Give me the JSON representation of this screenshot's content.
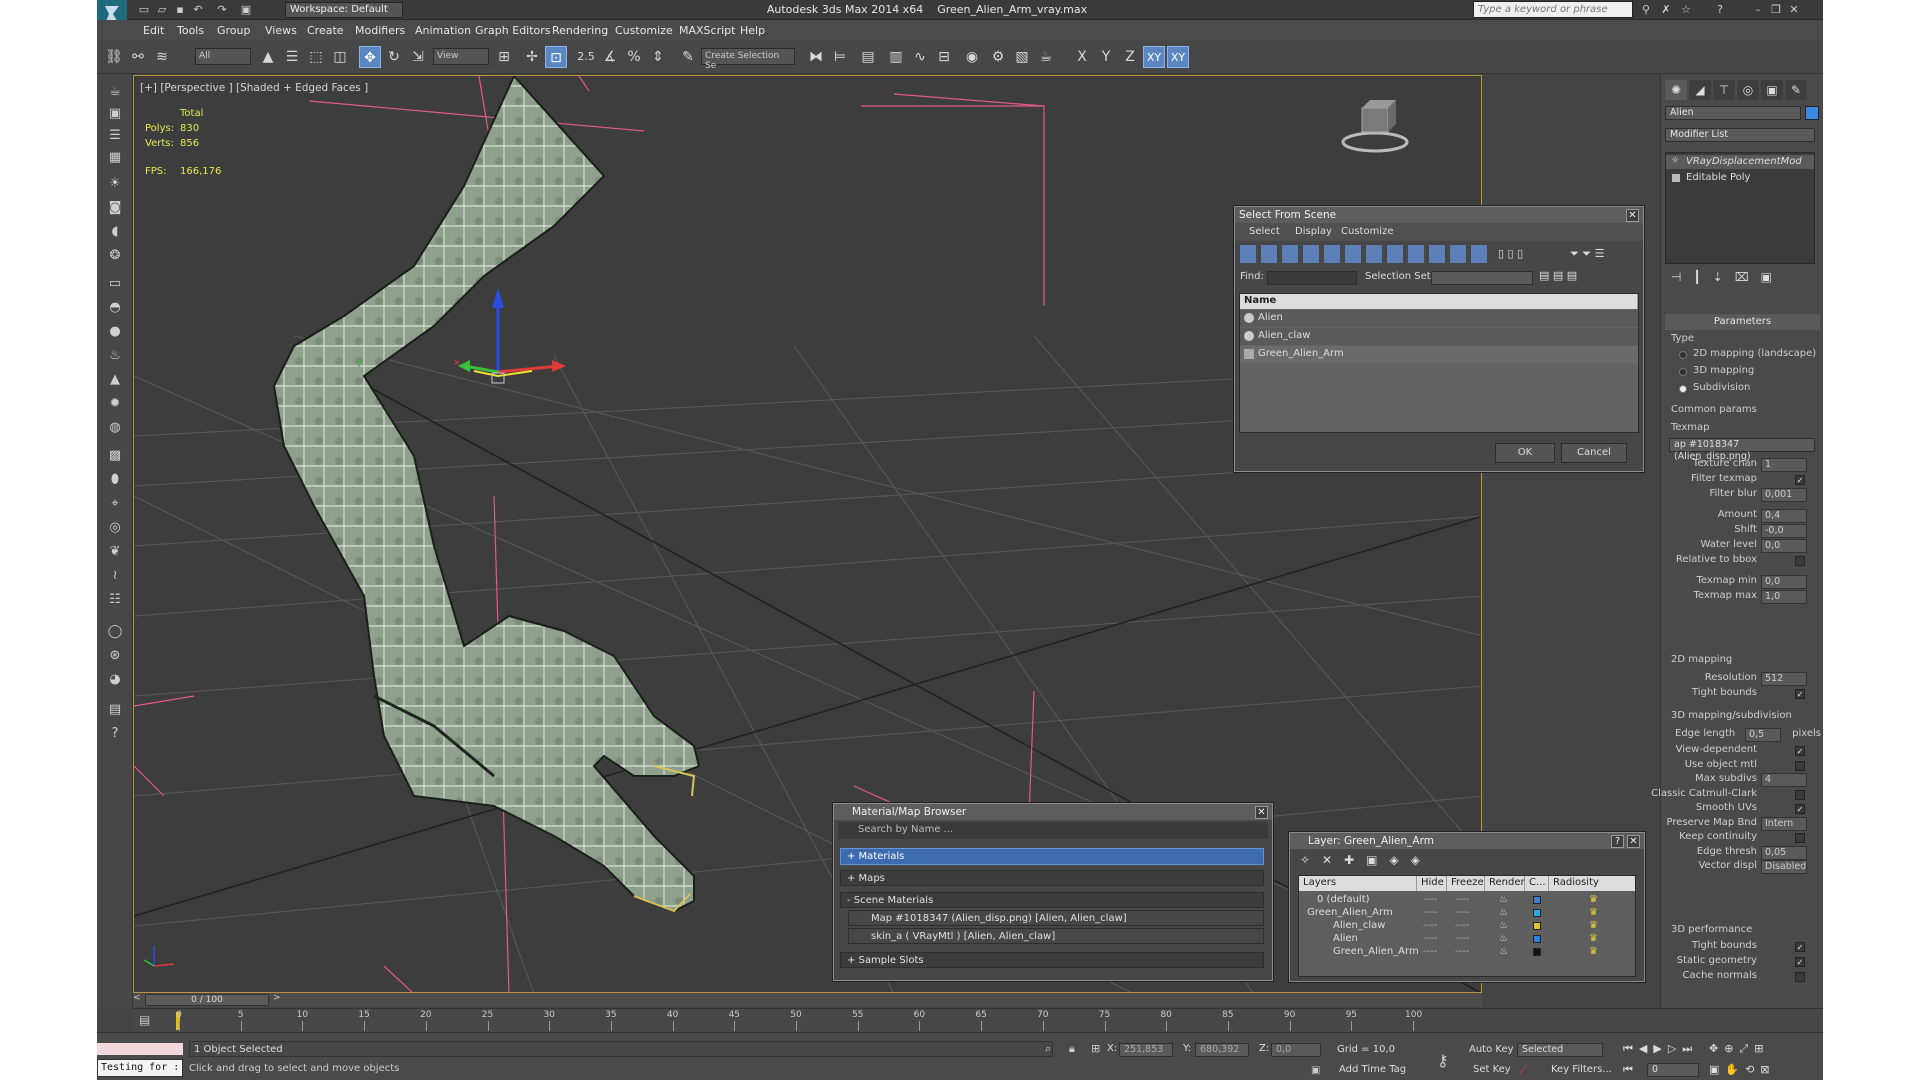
{
  "title": {
    "app": "Autodesk 3ds Max  2014 x64",
    "file": "Green_Alien_Arm_vray.max",
    "workspace": "Workspace: Default",
    "search_placeholder": "Type a keyword or phrase"
  },
  "menu": [
    "Edit",
    "Tools",
    "Group",
    "Views",
    "Create",
    "Modifiers",
    "Animation",
    "Graph Editors",
    "Rendering",
    "Customize",
    "MAXScript",
    "Help"
  ],
  "toolbar": {
    "filter": "All",
    "ref_coord": "View",
    "snap_label": "2.5",
    "named_sel": "Create Selection Se",
    "axis": [
      "X",
      "Y",
      "Z",
      "XY",
      "XY"
    ]
  },
  "viewport": {
    "label": "[+] [Perspective ] [Shaded + Edged Faces ]",
    "stats": {
      "total": "Total",
      "polys_label": "Polys:",
      "polys": "830",
      "verts_label": "Verts:",
      "verts": "856",
      "fps_label": "FPS:",
      "fps": "166,176"
    },
    "gizmo_x": "x",
    "gizmo_y": "y"
  },
  "select_dialog": {
    "title": "Select From Scene",
    "menus": [
      "Select",
      "Display",
      "Customize"
    ],
    "find_label": "Find:",
    "selset_label": "Selection Set:",
    "col_name": "Name",
    "items": [
      "Alien",
      "Alien_claw",
      "Green_Alien_Arm"
    ],
    "ok": "OK",
    "cancel": "Cancel"
  },
  "mat_browser": {
    "title": "Material/Map Browser",
    "search": "Search by Name ...",
    "materials": "+ Materials",
    "maps": "+ Maps",
    "scene_materials": "- Scene Materials",
    "rows": [
      "Map #1018347 (Alien_disp.png)  [Alien, Alien_claw]",
      "skin_a  ( VRayMtl )  [Alien, Alien_claw]"
    ],
    "sample_slots": "+ Sample Slots"
  },
  "layer_dialog": {
    "title": "Layer: Green_Alien_Arm",
    "help": "?",
    "cols": [
      "Layers",
      "Hide",
      "Freeze",
      "Render",
      "C...",
      "Radiosity"
    ],
    "rows": [
      {
        "name": "0 (default)",
        "color": "#3a7fd0"
      },
      {
        "name": "Green_Alien_Arm",
        "color": "#2aa8e0"
      },
      {
        "name": "Alien_claw",
        "color": "#e0c030"
      },
      {
        "name": "Alien",
        "color": "#2a7fe0"
      },
      {
        "name": "Green_Alien_Arm",
        "color": "#111111"
      }
    ],
    "dots": "----"
  },
  "panel": {
    "object_name": "Alien",
    "modifier_list": "Modifier List",
    "stack": [
      "VRayDisplacementMod",
      "Editable Poly"
    ],
    "params_title": "Parameters",
    "type_label": "Type",
    "types": [
      "2D mapping (landscape)",
      "3D mapping",
      "Subdivision"
    ],
    "common_label": "Common params",
    "texmap_label": "Texmap",
    "texmap": "ap #1018347 (Alien_disp.png)",
    "rows1": [
      {
        "label": "Texture chan",
        "value": "1"
      },
      {
        "label": "Filter texmap",
        "check": "✓"
      },
      {
        "label": "Filter blur",
        "value": "0,001"
      },
      {
        "label": "Amount",
        "value": "0,4"
      },
      {
        "label": "Shift",
        "value": "-0,0"
      },
      {
        "label": "Water level",
        "value": "0,0"
      },
      {
        "label": "Relative to bbox",
        "check": ""
      },
      {
        "label": "Texmap min",
        "value": "0,0"
      },
      {
        "label": "Texmap max",
        "value": "1,0"
      }
    ],
    "map2d_label": "2D mapping",
    "rows2": [
      {
        "label": "Resolution",
        "value": "512"
      },
      {
        "label": "Tight bounds",
        "check": "✓"
      }
    ],
    "map3d_label": "3D mapping/subdivision",
    "edge_length_label": "Edge length",
    "edge_length": "0,5",
    "pixels": "pixels",
    "rows3": [
      {
        "label": "View-dependent",
        "check": "✓"
      },
      {
        "label": "Use object mtl",
        "check": ""
      },
      {
        "label": "Max subdivs",
        "value": "4"
      },
      {
        "label": "Classic Catmull-Clark",
        "check": ""
      },
      {
        "label": "Smooth UVs",
        "check": "✓"
      },
      {
        "label": "Preserve Map Bnd",
        "value": "Intern"
      },
      {
        "label": "Keep continuity",
        "check": ""
      },
      {
        "label": "Edge thresh",
        "value": "0,05"
      },
      {
        "label": "Vector displ",
        "value": "Disabled"
      }
    ],
    "perf_label": "3D performance",
    "rows4": [
      {
        "label": "Tight bounds",
        "check": "✓"
      },
      {
        "label": "Static geometry",
        "check": "✓"
      },
      {
        "label": "Cache normals",
        "check": ""
      }
    ]
  },
  "timeline": {
    "frame": "0 / 100",
    "ticks": [
      "0",
      "5",
      "10",
      "15",
      "20",
      "25",
      "30",
      "35",
      "40",
      "45",
      "50",
      "55",
      "60",
      "65",
      "70",
      "75",
      "80",
      "85",
      "90",
      "95",
      "100"
    ]
  },
  "status": {
    "script": "Testing for :",
    "selected": "1 Object Selected",
    "prompt": "Click and drag to select and move objects",
    "x_label": "X:",
    "x": "251,853",
    "y_label": "Y:",
    "y": "680,392",
    "z_label": "Z:",
    "z": "0,0",
    "grid": "Grid = 10,0",
    "auto_key": "Auto Key",
    "set_key": "Set Key",
    "sel_mode": "Selected",
    "key_filters": "Key Filters...",
    "add_time_tag": "Add Time Tag",
    "cur_frame": "0"
  }
}
